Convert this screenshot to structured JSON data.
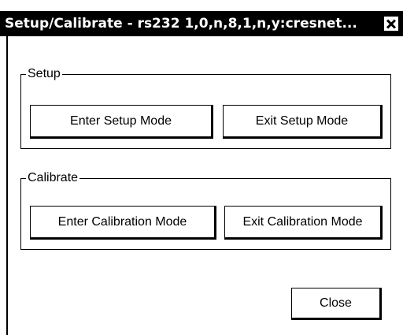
{
  "window": {
    "title": "Setup/Calibrate - rs232 1,0,n,8,1,n,y:cresnet..."
  },
  "setup": {
    "legend": "Setup",
    "enter_label": "Enter Setup Mode",
    "exit_label": "Exit Setup Mode"
  },
  "calibrate": {
    "legend": "Calibrate",
    "enter_label": "Enter Calibration Mode",
    "exit_label": "Exit Calibration Mode"
  },
  "footer": {
    "close_label": "Close"
  }
}
